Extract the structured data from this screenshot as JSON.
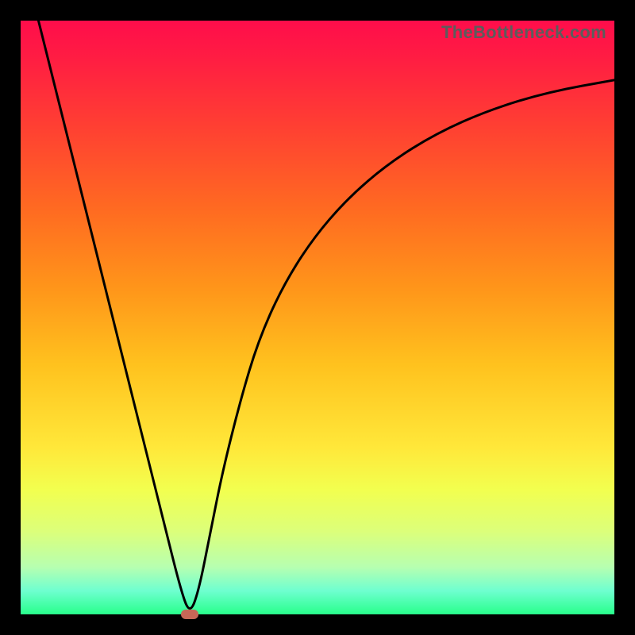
{
  "watermark": "TheBottleneck.com",
  "colors": {
    "frame": "#000000",
    "curve": "#000000",
    "optimum": "#c66757",
    "gradient_top": "#ff0d4b",
    "gradient_bottom": "#28ff8b"
  },
  "chart_data": {
    "type": "line",
    "title": "",
    "xlabel": "",
    "ylabel": "",
    "xlim": [
      0,
      100
    ],
    "ylim": [
      0,
      100
    ],
    "series": [
      {
        "name": "bottleneck-curve",
        "x": [
          3,
          6,
          9,
          12,
          15,
          18,
          21,
          24,
          27,
          28.5,
          30,
          32,
          34,
          37,
          40,
          44,
          49,
          55,
          62,
          70,
          79,
          89,
          100
        ],
        "y": [
          100,
          88,
          76,
          64,
          52,
          40,
          28,
          16,
          4,
          0,
          4,
          14,
          24,
          36,
          46,
          55,
          63,
          70,
          76,
          81,
          85,
          88,
          90
        ]
      }
    ],
    "optimum_point": {
      "x": 28.5,
      "y": 0
    }
  }
}
